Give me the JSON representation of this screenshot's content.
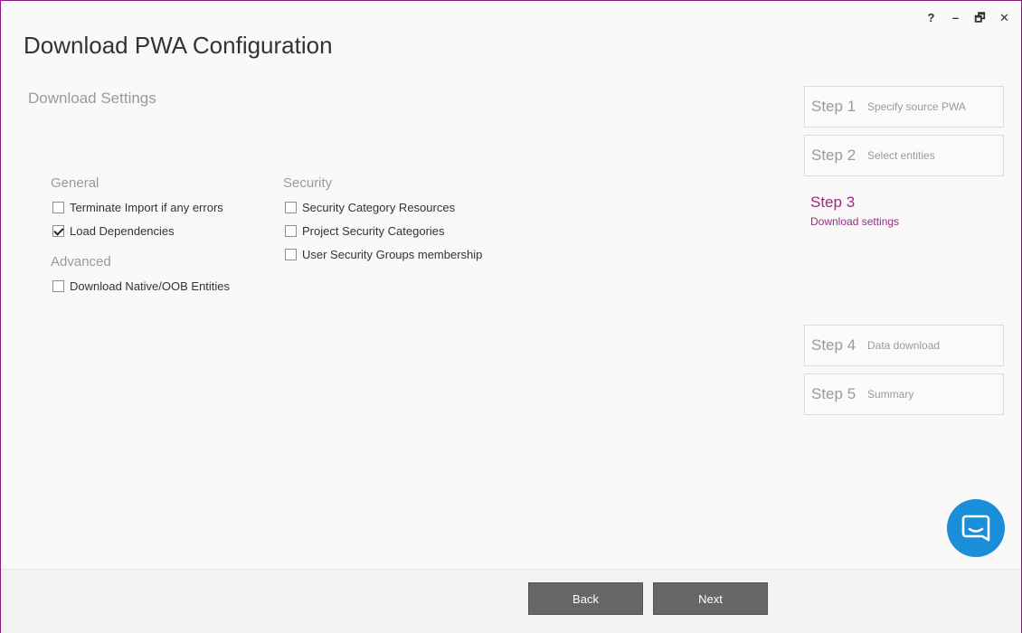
{
  "window": {
    "title": "Download PWA Configuration",
    "controls": {
      "help": "?",
      "minimize": "–",
      "restore": "🗗",
      "close": "✕"
    }
  },
  "page": {
    "subtitle": "Download Settings"
  },
  "groups": {
    "general": {
      "heading": "General",
      "options": [
        {
          "label": "Terminate Import if any errors",
          "checked": false
        },
        {
          "label": "Load Dependencies",
          "checked": true
        }
      ]
    },
    "advanced": {
      "heading": "Advanced",
      "options": [
        {
          "label": "Download Native/OOB Entities",
          "checked": false
        }
      ]
    },
    "security": {
      "heading": "Security",
      "options": [
        {
          "label": "Security Category Resources",
          "checked": false
        },
        {
          "label": "Project Security Categories",
          "checked": false
        },
        {
          "label": "User Security Groups membership",
          "checked": false
        }
      ]
    }
  },
  "steps": [
    {
      "num": "Step 1",
      "label": "Specify source PWA",
      "active": false
    },
    {
      "num": "Step 2",
      "label": "Select entities",
      "active": false
    },
    {
      "num": "Step 3",
      "label": "Download settings",
      "active": true
    },
    {
      "num": "Step 4",
      "label": "Data download",
      "active": false
    },
    {
      "num": "Step 5",
      "label": "Summary",
      "active": false
    }
  ],
  "footer": {
    "back_label": "Back",
    "next_label": "Next"
  },
  "colors": {
    "accent": "#9b2a86",
    "chat": "#1a8fd8",
    "button": "#666666"
  },
  "icons": {
    "chat": "chat-bubble-icon"
  }
}
